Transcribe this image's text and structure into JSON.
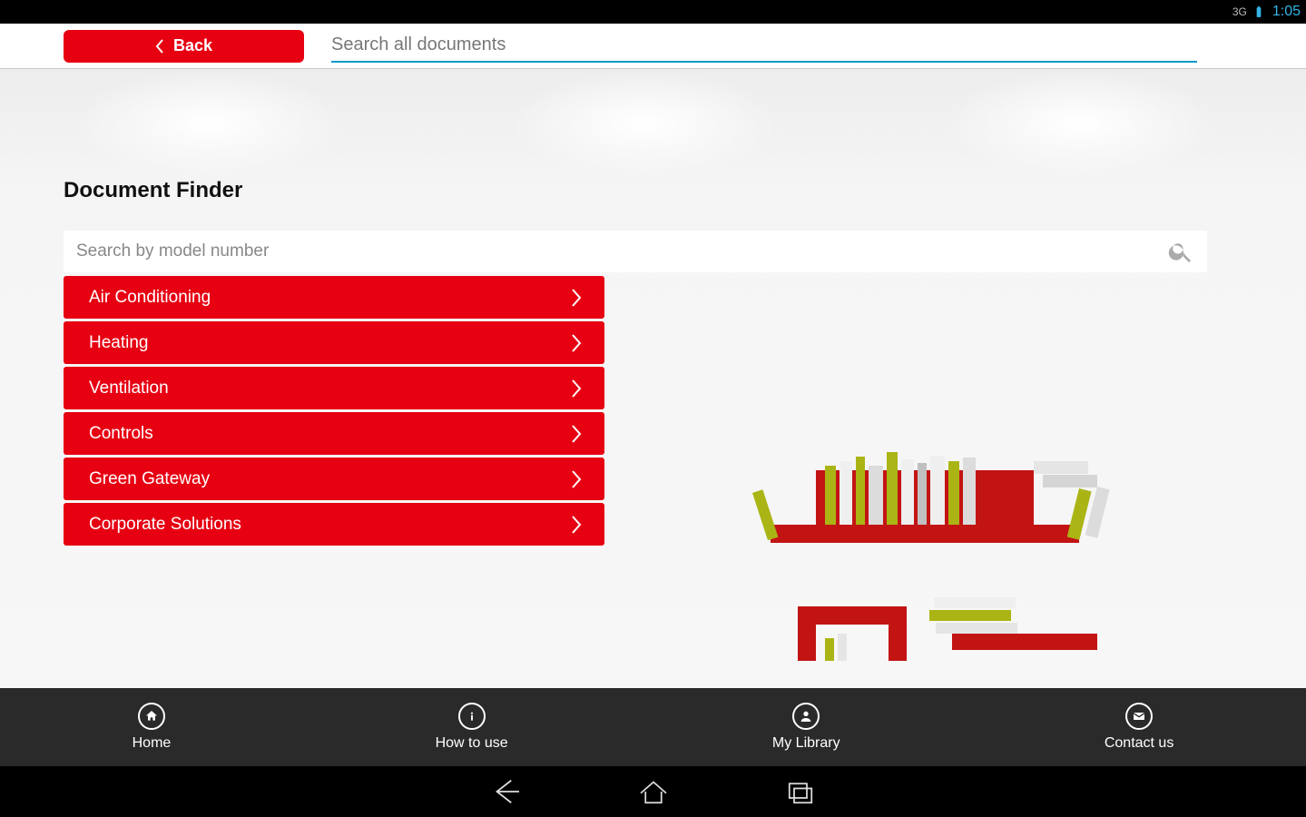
{
  "status": {
    "network": "3G",
    "clock": "1:05"
  },
  "header": {
    "back_label": "Back",
    "search_placeholder": "Search all documents"
  },
  "page": {
    "title": "Document Finder",
    "model_search_placeholder": "Search by model number"
  },
  "categories": [
    "Air Conditioning",
    "Heating",
    "Ventilation",
    "Controls",
    "Green Gateway",
    "Corporate Solutions"
  ],
  "tabs": {
    "home": "Home",
    "how": "How to use",
    "library": "My Library",
    "contact": "Contact us"
  }
}
